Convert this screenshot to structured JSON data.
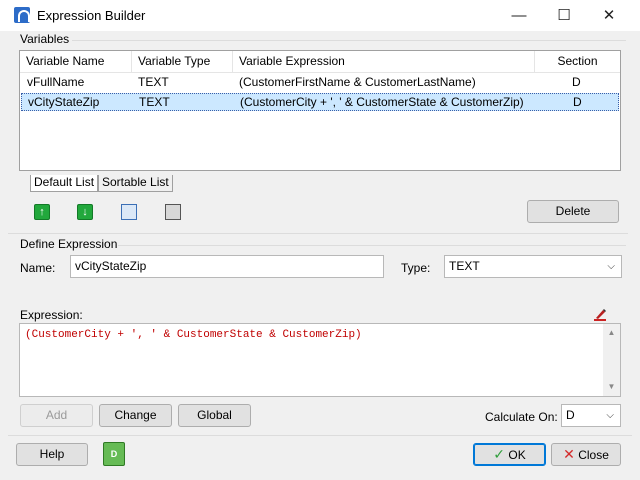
{
  "window": {
    "title": "Expression Builder"
  },
  "variables_group": {
    "label": "Variables"
  },
  "variables_table": {
    "headers": [
      "Variable Name",
      "Variable Type",
      "Variable Expression",
      "Section"
    ],
    "rows": [
      {
        "name": "vFullName",
        "type": "TEXT",
        "expression": "(CustomerFirstName & CustomerLastName)",
        "section": "D"
      },
      {
        "name": "vCityStateZip",
        "type": "TEXT",
        "expression": "(CustomerCity + ', ' & CustomerState & CustomerZip)",
        "section": "D"
      }
    ],
    "selected_row": 1
  },
  "tabs": [
    {
      "label": "Default List"
    },
    {
      "label": "Sortable List"
    }
  ],
  "toolbar": {
    "move_up_icon": "arrow-up-icon",
    "move_down_icon": "arrow-down-icon",
    "copy_icon": "copy-icon",
    "paste_icon": "paste-icon",
    "delete_label": "Delete"
  },
  "define_group": {
    "label": "Define Expression"
  },
  "name_field": {
    "label": "Name:",
    "value": "vCityStateZip"
  },
  "type_field": {
    "label": "Type:",
    "value": "TEXT"
  },
  "expression": {
    "label": "Expression:",
    "value": "(CustomerCity + ', ' & CustomerState & CustomerZip)",
    "color": "#c00000"
  },
  "actions": {
    "add_label": "Add",
    "change_label": "Change",
    "global_label": "Global"
  },
  "calculate_on": {
    "label": "Calculate On:",
    "value": "D"
  },
  "footer": {
    "help_label": "Help",
    "ok_label": "OK",
    "close_label": "Close"
  },
  "colors": {
    "accent": "#0078d7",
    "selection": "#cce8ff",
    "ok_check": "#2e9e3a",
    "close_x": "#d42a2a"
  }
}
